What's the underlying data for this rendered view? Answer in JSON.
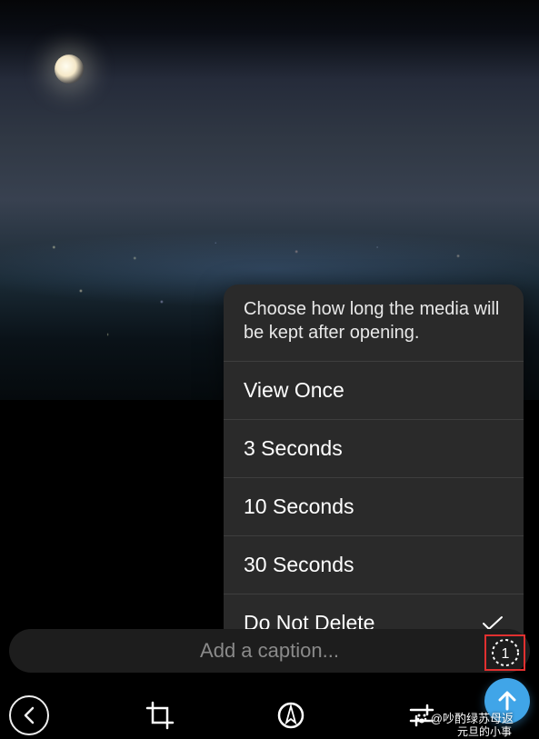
{
  "popup": {
    "header": "Choose how long the media will be kept after opening.",
    "options": [
      "View Once",
      "3 Seconds",
      "10 Seconds",
      "30 Seconds",
      "Do Not Delete"
    ],
    "selectedIndex": 4
  },
  "caption": {
    "placeholder": "Add a caption..."
  },
  "timer": {
    "value": "1"
  },
  "watermark": {
    "text1": "@吵酌绿苏母返",
    "text2": "元旦的小事"
  }
}
